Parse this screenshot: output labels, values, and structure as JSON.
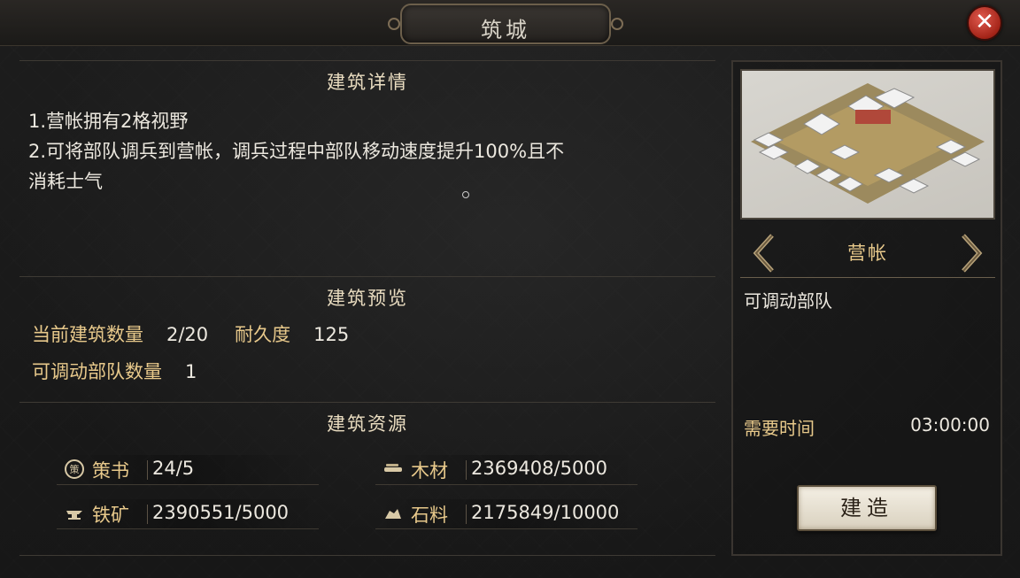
{
  "window": {
    "title": "筑城",
    "close_icon": "close-icon"
  },
  "sections": {
    "detail_title": "建筑详情",
    "detail_lines": [
      "1.营帐拥有2格视野",
      "2.可将部队调兵到营帐，调兵过程中部队移动速度提升100%且不",
      "消耗士气"
    ],
    "preview_title": "建筑预览",
    "resources_title": "建筑资源"
  },
  "preview": {
    "count_label": "当前建筑数量",
    "count_value": "2/20",
    "durability_label": "耐久度",
    "durability_value": "125",
    "troops_label": "可调动部队数量",
    "troops_value": "1"
  },
  "resources": [
    {
      "icon": "strategy-book-icon",
      "label": "策书",
      "value": "24/5"
    },
    {
      "icon": "wood-icon",
      "label": "木材",
      "value": "2369408/5000"
    },
    {
      "icon": "iron-anvil-icon",
      "label": "铁矿",
      "value": "2390551/5000"
    },
    {
      "icon": "stone-icon",
      "label": "石料",
      "value": "2175849/10000"
    }
  ],
  "building": {
    "name": "营帐",
    "description": "可调动部队",
    "time_label": "需要时间",
    "time_value": "03:00:00",
    "build_label": "建造",
    "image_icon": "camp-tents-icon"
  },
  "colors": {
    "accent_gold": "#e8c98b",
    "close_red": "#c0392b",
    "text": "#ece8df"
  }
}
